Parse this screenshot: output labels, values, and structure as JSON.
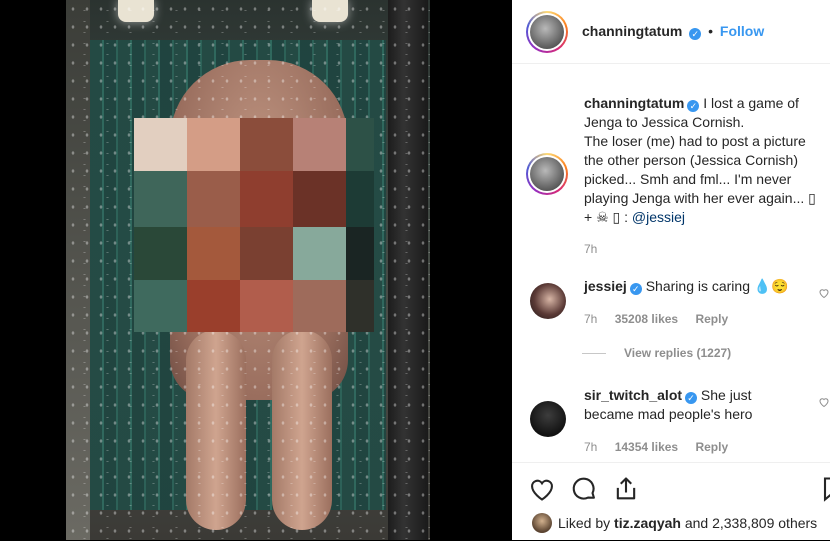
{
  "post": {
    "username": "channingtatum",
    "follow_label": "Follow",
    "separator": "•"
  },
  "caption": {
    "username": "channingtatum",
    "text_lines": [
      "I lost a game of",
      "Jenga to Jessica Cornish.",
      "The loser (me) had to post a picture",
      "the other person (Jessica Cornish)",
      "picked... Smh and fml... I'm never",
      "playing Jenga with her ever again... ▯",
      "+ ☠ ▯ : "
    ],
    "mention": "@jessiej",
    "time": "7h"
  },
  "comments": [
    {
      "username": "jessiej",
      "text": "Sharing is caring 💧😌",
      "time": "7h",
      "likes": "35208 likes",
      "reply_label": "Reply",
      "view_replies": "View replies (1227)"
    },
    {
      "username": "sir_twitch_alot",
      "text_lines": [
        "She just",
        "became mad people's hero"
      ],
      "time": "7h",
      "likes": "14354 likes",
      "reply_label": "Reply"
    }
  ],
  "likes_bar": {
    "prefix": "Liked by",
    "user": "tiz.zaqyah",
    "suffix": "and 2,338,809 others"
  },
  "icons": {
    "like": "heart-icon",
    "comment": "comment-icon",
    "share": "share-icon",
    "save": "bookmark-icon",
    "verified": "verified-badge-icon"
  },
  "colors": {
    "link": "#003569",
    "follow": "#3897f0",
    "verified": "#3897f0",
    "text": "#262626",
    "muted": "#8e8e8e"
  },
  "mosaic_colors": [
    "#e2cfc0",
    "#d49d86",
    "#8b4d3b",
    "#b78176",
    "#2d5147",
    "#3f665a",
    "#9a5d4a",
    "#8f3e2f",
    "#6b3227",
    "#1d3b35",
    "#2a4838",
    "#a4593c",
    "#7a4031",
    "#87a99b",
    "#1a2523",
    "#3f6a5e",
    "#9a3f2c",
    "#b15d4c",
    "#9e6b5b",
    "#2f302a"
  ]
}
